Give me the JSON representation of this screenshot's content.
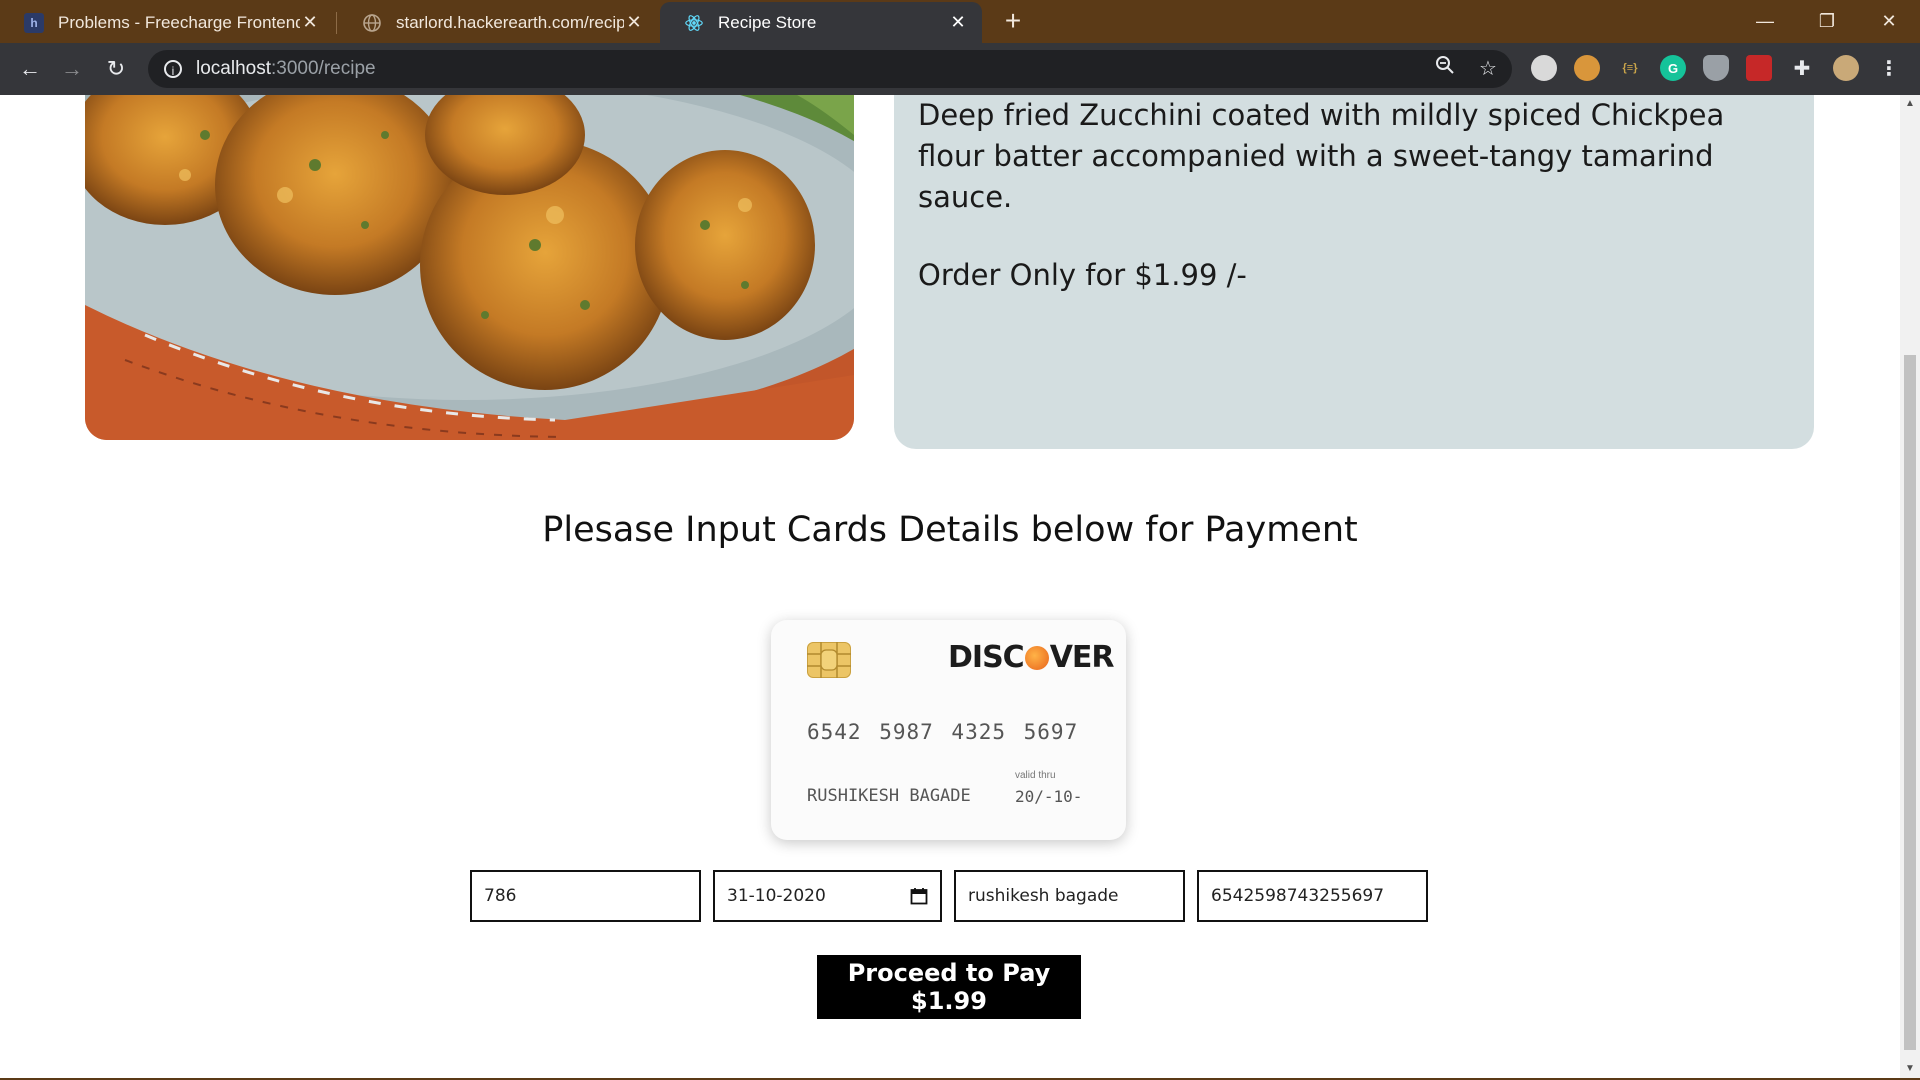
{
  "browser": {
    "tabs": [
      {
        "title": "Problems - Freecharge Frontend",
        "favicon": "hackerearth-icon",
        "active": false
      },
      {
        "title": "starlord.hackerearth.com/recipe",
        "favicon": "globe-icon",
        "active": false
      },
      {
        "title": "Recipe Store",
        "favicon": "react-icon",
        "active": true
      }
    ],
    "new_tab_symbol": "+",
    "url_host": "localhost",
    "url_rest": ":3000/recipe",
    "extensions": [
      "cube-extension-icon",
      "cookie-extension-icon",
      "bracket-extension-icon",
      "grammarly-icon",
      "shield-extension-icon",
      "red-extension-icon",
      "puzzle-icon",
      "profile-avatar"
    ],
    "extension_labels": {
      "grammarly": "G",
      "bracket": "{≡}"
    }
  },
  "recipe": {
    "image_alt": "Deep fried zucchini fritters on a plate",
    "description": "Deep fried Zucchini coated with mildly spiced Chickpea flour batter accompanied with a sweet-tangy tamarind sauce.",
    "price_text": "Order Only for $1.99 /-"
  },
  "payment": {
    "heading": "Plesase Input Cards Details below for Payment",
    "card": {
      "brand_left": "DISC",
      "brand_right": "VER",
      "number": "6542 5987 4325 5697",
      "name": "RUSHIKESH BAGADE",
      "valid_label": "valid thru",
      "expiry": "20/-10-"
    },
    "fields": {
      "cvc": "786",
      "expiry": "31-10-2020",
      "name": "rushikesh bagade",
      "number": "6542598743255697"
    },
    "button_label": "Proceed to Pay $1.99"
  },
  "colors": {
    "tabbar": "#5b3a17",
    "toolbar": "#35363a",
    "description_card": "#d3dee0",
    "button": "#000000"
  }
}
